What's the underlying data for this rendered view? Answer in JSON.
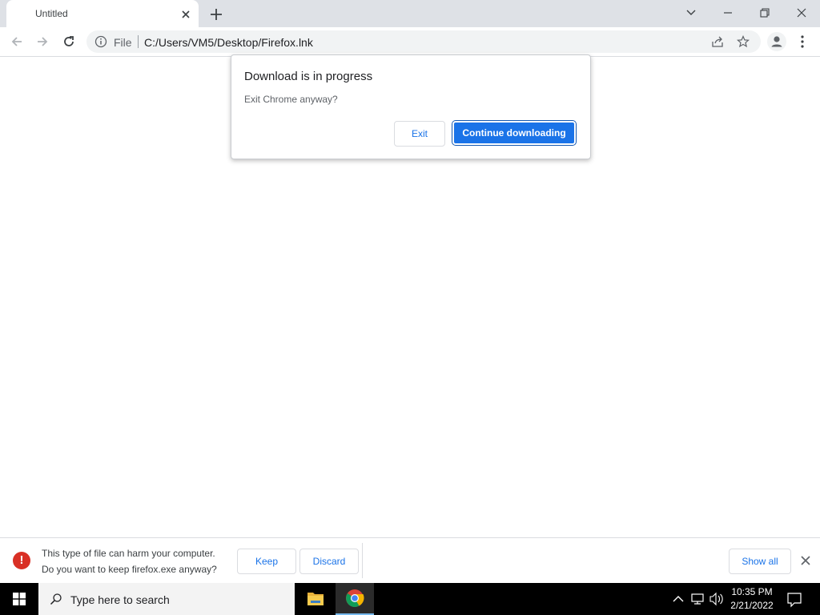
{
  "browser": {
    "tab": {
      "title": "Untitled"
    },
    "omnibox": {
      "scheme": "File",
      "url": "C:/Users/VM5/Desktop/Firefox.lnk"
    }
  },
  "dialog": {
    "title": "Download is in progress",
    "message": "Exit Chrome anyway?",
    "exit_label": "Exit",
    "continue_label": "Continue downloading"
  },
  "download_shelf": {
    "warning_line1": "This type of file can harm your computer.",
    "warning_line2": "Do you want to keep firefox.exe anyway?",
    "keep_label": "Keep",
    "discard_label": "Discard",
    "show_all_label": "Show all"
  },
  "taskbar": {
    "search_placeholder": "Type here to search",
    "time": "10:35 PM",
    "date": "2/21/2022"
  },
  "colors": {
    "accent": "#1a73e8",
    "warning": "#d93025",
    "tab_strip": "#dee1e6",
    "taskbar": "#000000"
  },
  "icons": [
    "close-icon",
    "plus-icon",
    "chevron-down-icon",
    "minimize-icon",
    "restore-icon",
    "back-icon",
    "forward-icon",
    "reload-icon",
    "info-icon",
    "share-icon",
    "star-icon",
    "profile-icon",
    "menu-icon",
    "warning-icon",
    "windows-icon",
    "search-icon",
    "folder-icon",
    "chrome-icon",
    "chevron-up-icon",
    "network-icon",
    "volume-icon",
    "notification-icon"
  ]
}
